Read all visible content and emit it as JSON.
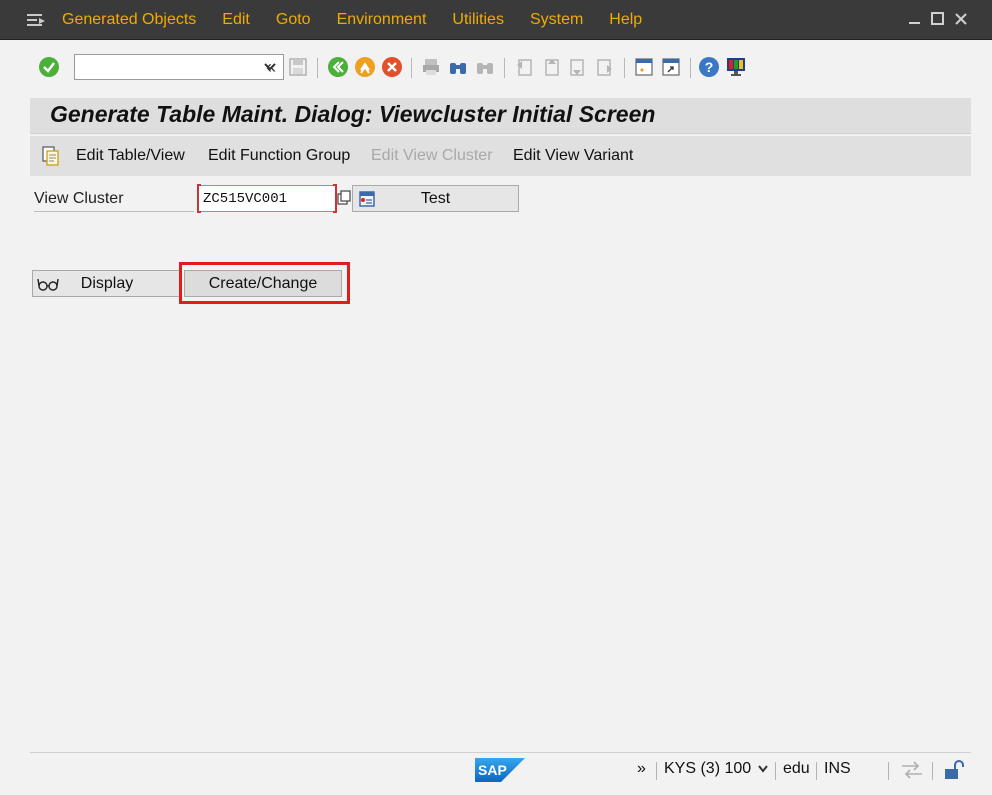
{
  "menu": {
    "items": [
      "Generated Objects",
      "Edit",
      "Goto",
      "Environment",
      "Utilities",
      "System",
      "Help"
    ]
  },
  "toolbar": {
    "command_value": "",
    "back_glyph": "«"
  },
  "title": "Generate Table Maint. Dialog: Viewcluster Initial Screen",
  "app_toolbar": {
    "edit_table_view": "Edit Table/View",
    "edit_function_group": "Edit Function Group",
    "edit_view_cluster": "Edit View Cluster",
    "edit_view_variant": "Edit View Variant"
  },
  "form": {
    "view_cluster_label": "View Cluster",
    "view_cluster_value": "ZC515VC001",
    "test_label": "Test",
    "display_label": "Display",
    "create_change_label": "Create/Change"
  },
  "status": {
    "expand_glyph": "»",
    "system": "KYS (3) 100",
    "user": "edu",
    "mode": "INS",
    "logo": "SAP"
  },
  "colors": {
    "menu_text": "#f0ab00",
    "highlight": "#e21b1b",
    "sap_blue": "#1a7bd4"
  }
}
